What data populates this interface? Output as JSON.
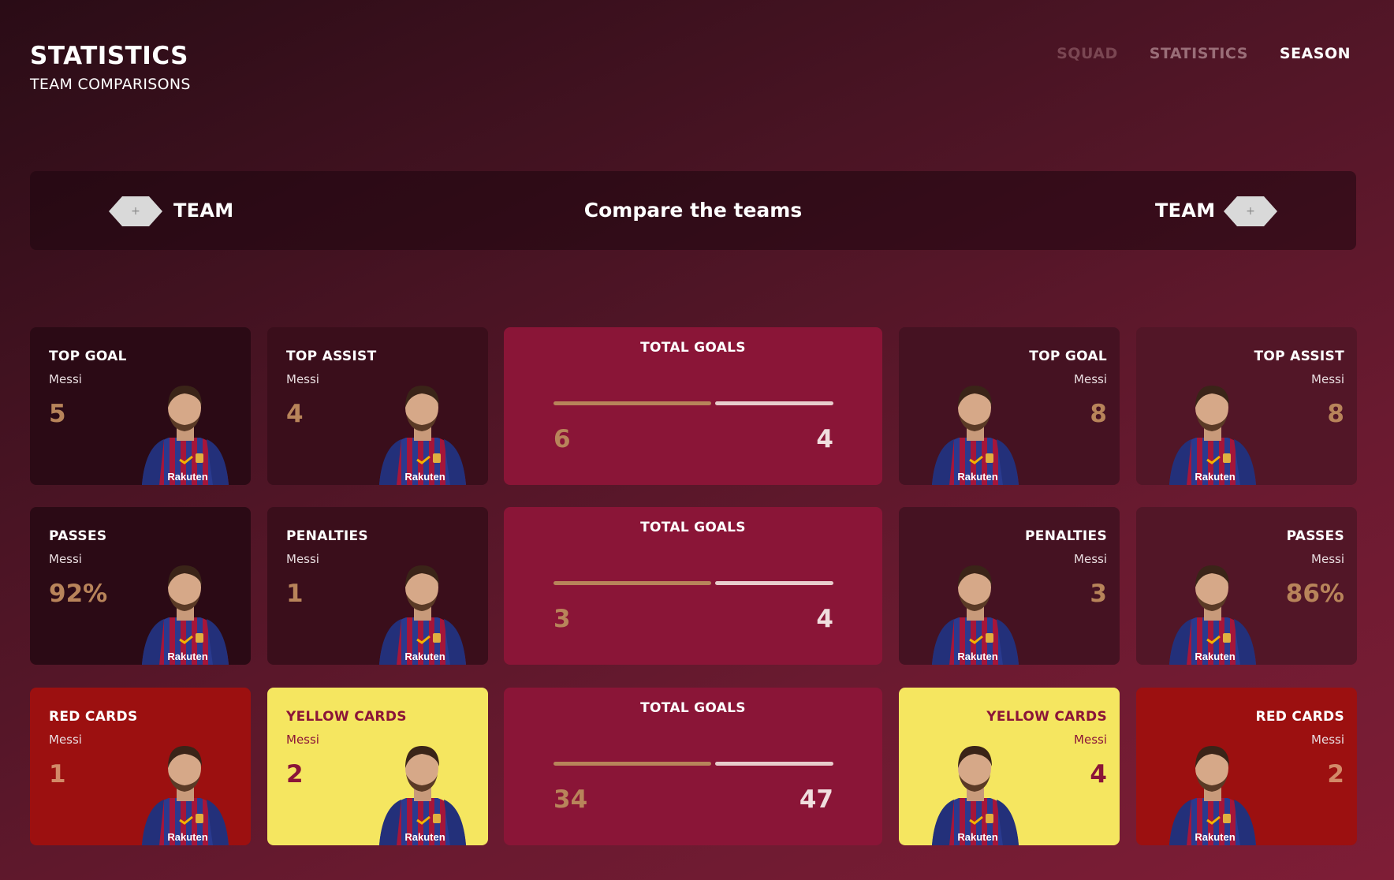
{
  "header": {
    "title": "STATISTICS",
    "subtitle": "TEAM COMPARISONS"
  },
  "nav": {
    "items": [
      "SQUAD",
      "STATISTICS",
      "SEASON"
    ],
    "active": "SEASON"
  },
  "compare": {
    "left_team": "TEAM",
    "right_team": "TEAM",
    "title": "Compare the teams",
    "add_symbol": "+"
  },
  "rows": [
    {
      "left": [
        {
          "label": "TOP GOAL",
          "player": "Messi",
          "value": "5"
        },
        {
          "label": "TOP ASSIST",
          "player": "Messi",
          "value": "4"
        }
      ],
      "total": {
        "label": "TOTAL GOALS",
        "left_value": "6",
        "right_value": "4"
      },
      "right": [
        {
          "label": "TOP GOAL",
          "player": "Messi",
          "value": "8"
        },
        {
          "label": "TOP ASSIST",
          "player": "Messi",
          "value": "8"
        }
      ]
    },
    {
      "left": [
        {
          "label": "PASSES",
          "player": "Messi",
          "value": "92%"
        },
        {
          "label": "PENALTIES",
          "player": "Messi",
          "value": "1"
        }
      ],
      "total": {
        "label": "TOTAL GOALS",
        "left_value": "3",
        "right_value": "4"
      },
      "right": [
        {
          "label": "PENALTIES",
          "player": "Messi",
          "value": "3"
        },
        {
          "label": "PASSES",
          "player": "Messi",
          "value": "86%"
        }
      ]
    },
    {
      "left": [
        {
          "label": "RED CARDS",
          "player": "Messi",
          "value": "1"
        },
        {
          "label": "YELLOW CARDS",
          "player": "Messi",
          "value": "2"
        }
      ],
      "total": {
        "label": "TOTAL GOALS",
        "left_value": "34",
        "right_value": "47"
      },
      "right": [
        {
          "label": "YELLOW CARDS",
          "player": "Messi",
          "value": "4"
        },
        {
          "label": "RED CARDS",
          "player": "Messi",
          "value": "2"
        }
      ]
    }
  ],
  "colors": {
    "accent_gold": "#b8845a",
    "total_card": "#8a1537",
    "red_card": "#9c1010",
    "yellow_card": "#f5e660",
    "jersey_blue": "#2a3a8f",
    "jersey_red": "#a5163a"
  },
  "icons": {
    "player_image": "player-photo-icon",
    "add": "plus-icon"
  }
}
